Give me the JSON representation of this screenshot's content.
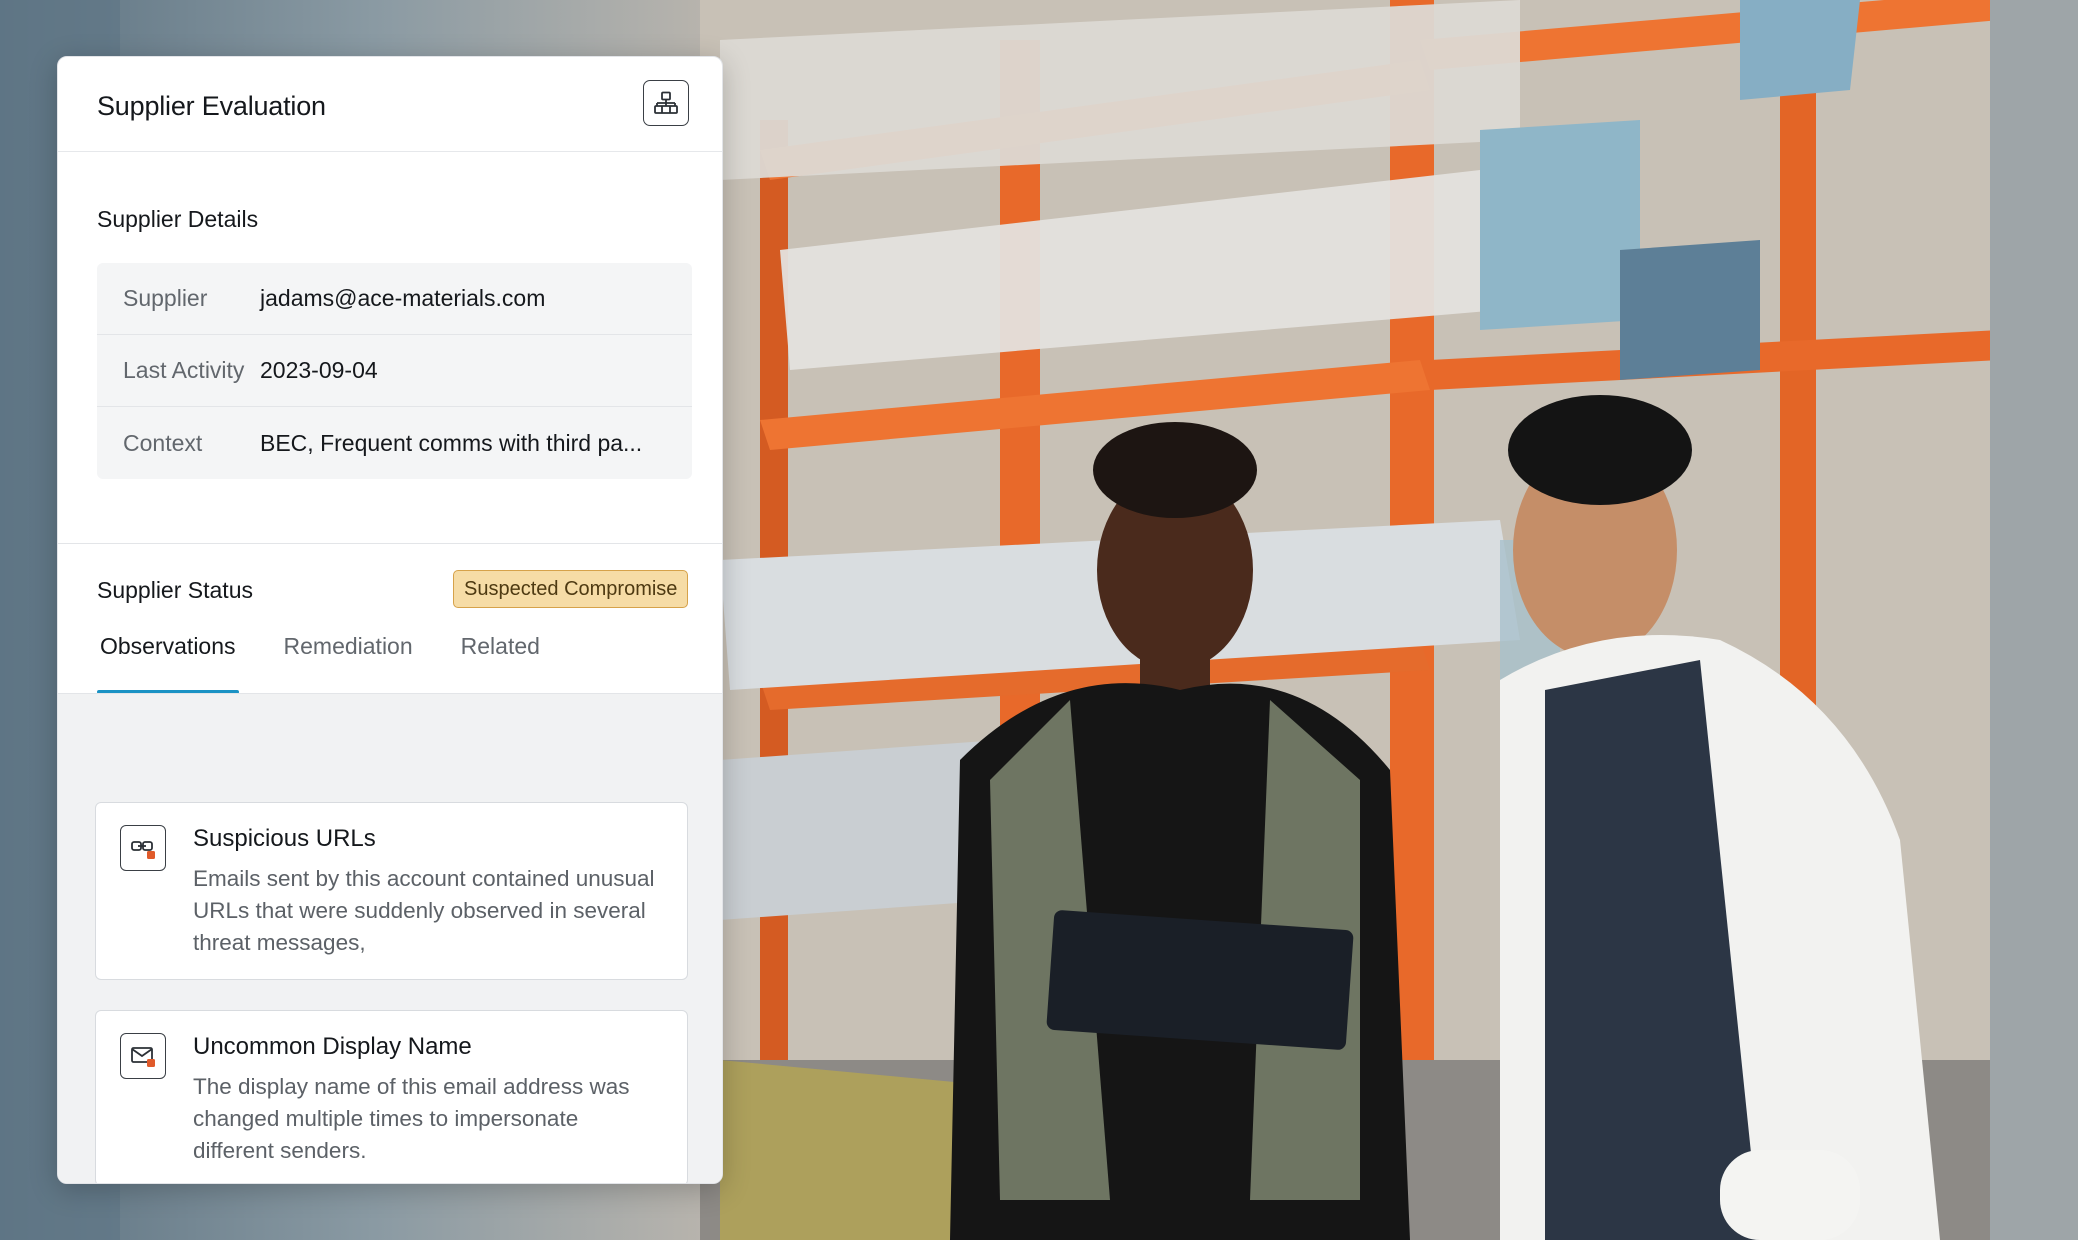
{
  "panel": {
    "title": "Supplier Evaluation",
    "header_icon": "hierarchy-icon"
  },
  "details": {
    "title": "Supplier Details",
    "rows": [
      {
        "label": "Supplier",
        "value": "jadams@ace-materials.com"
      },
      {
        "label": "Last Activity",
        "value": "2023-09-04"
      },
      {
        "label": "Context",
        "value": "BEC, Frequent comms with third pa..."
      }
    ]
  },
  "status": {
    "title": "Supplier Status",
    "badge": "Suspected Compromise",
    "badge_color": "#f6dca6",
    "badge_border": "#d6a24a"
  },
  "tabs": [
    {
      "label": "Observations",
      "active": true
    },
    {
      "label": "Remediation",
      "active": false
    },
    {
      "label": "Related",
      "active": false
    }
  ],
  "accent": "#1a92c4",
  "observations": [
    {
      "icon": "link-alert-icon",
      "title": "Suspicious URLs",
      "description": "Emails sent by this account contained unusual URLs that were suddenly observed in several threat messages,"
    },
    {
      "icon": "mail-alert-icon",
      "title": "Uncommon Display Name",
      "description": "The display name of this email address was changed multiple times to impersonate different senders."
    }
  ]
}
